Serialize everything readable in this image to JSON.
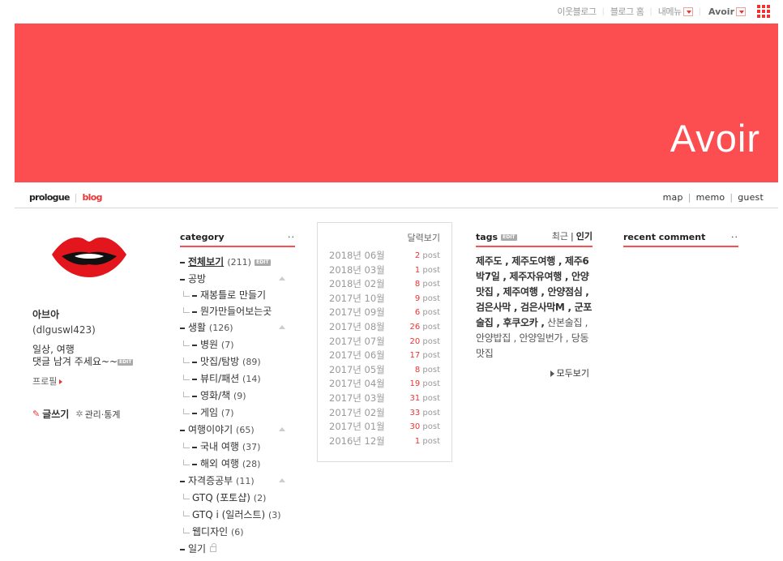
{
  "topbar": {
    "neighbor_blog": "이웃블로그",
    "blog_home": "블로그 홈",
    "my_menu": "내메뉴",
    "user": "Avoir"
  },
  "banner": {
    "title": "Avoir"
  },
  "nav": {
    "prologue": "prologue",
    "blog": "blog",
    "map": "map",
    "memo": "memo",
    "guest": "guest"
  },
  "profile": {
    "name": "아브아",
    "id": "(dlguswl423)",
    "desc_line1": "일상, 여행",
    "desc_line2": "댓글 남겨 주세요~~",
    "edit_badge": "EDIT",
    "profile_link": "프로필",
    "write": "글쓰기",
    "manage": "관리·통계"
  },
  "category": {
    "title": "category",
    "dots": "··",
    "items": [
      {
        "label": "전체보기",
        "count": "(211)",
        "type": "all"
      },
      {
        "label": "공방",
        "count": "",
        "type": "top",
        "collapse": true
      },
      {
        "label": "재봉틀로 만들기",
        "count": "",
        "type": "sub"
      },
      {
        "label": "뭔가만들어보는곳",
        "count": "",
        "type": "sub"
      },
      {
        "label": "생활",
        "count": "(126)",
        "type": "top",
        "collapse": true
      },
      {
        "label": "병원",
        "count": "(7)",
        "type": "sub"
      },
      {
        "label": "맛집/탐방",
        "count": "(89)",
        "type": "sub"
      },
      {
        "label": "뷰티/패션",
        "count": "(14)",
        "type": "sub"
      },
      {
        "label": "영화/책",
        "count": "(9)",
        "type": "sub"
      },
      {
        "label": "게임",
        "count": "(7)",
        "type": "sub"
      },
      {
        "label": "여행이야기",
        "count": "(65)",
        "type": "top",
        "collapse": true
      },
      {
        "label": "국내 여행",
        "count": "(37)",
        "type": "sub"
      },
      {
        "label": "해외 여행",
        "count": "(28)",
        "type": "sub"
      },
      {
        "label": "자격증공부",
        "count": "(11)",
        "type": "top",
        "collapse": true
      },
      {
        "label": "GTQ (포토샵)",
        "count": "(2)",
        "type": "subnodash"
      },
      {
        "label": "GTQ i (일러스트)",
        "count": "(3)",
        "type": "subnodash"
      },
      {
        "label": "웹디자인",
        "count": "(6)",
        "type": "subnodash"
      },
      {
        "label": "일기",
        "count": "",
        "type": "top",
        "lock": true
      }
    ]
  },
  "archive": {
    "head": "달력보기",
    "post_word": "post",
    "rows": [
      {
        "month": "2018년 06월",
        "count": "2"
      },
      {
        "month": "2018년 03월",
        "count": "1"
      },
      {
        "month": "2018년 02월",
        "count": "8"
      },
      {
        "month": "2017년 10월",
        "count": "9"
      },
      {
        "month": "2017년 09월",
        "count": "6"
      },
      {
        "month": "2017년 08월",
        "count": "26"
      },
      {
        "month": "2017년 07월",
        "count": "20"
      },
      {
        "month": "2017년 06월",
        "count": "17"
      },
      {
        "month": "2017년 05월",
        "count": "8"
      },
      {
        "month": "2017년 04월",
        "count": "19"
      },
      {
        "month": "2017년 03월",
        "count": "31"
      },
      {
        "month": "2017년 02월",
        "count": "33"
      },
      {
        "month": "2017년 01월",
        "count": "30"
      },
      {
        "month": "2016년 12월",
        "count": "1"
      }
    ]
  },
  "tags": {
    "title": "tags",
    "edit_badge": "EDIT",
    "tab_recent": "최근",
    "tab_popular": "인기",
    "bold_text": "제주도 , 제주도여행 , 제주6박7일 , 제주자유여행 , 안양맛집 , 제주여행 , 안양점심 , 검은사막 , 검은사막M , 군포술집 , 후쿠오카 ,",
    "normal_text": " 산본술집 , 안양밥집 , 안양일번가 , 당동맛집",
    "more": "모두보기"
  },
  "recent": {
    "title": "recent comment",
    "dots": "··"
  },
  "colors": {
    "accent": "#fc4d50",
    "link_red": "#e33"
  }
}
